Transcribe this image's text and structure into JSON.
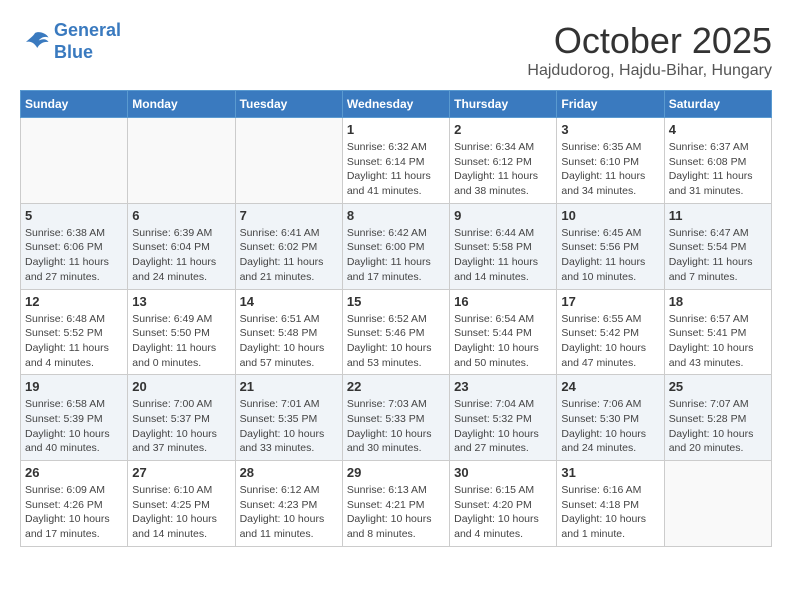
{
  "logo": {
    "line1": "General",
    "line2": "Blue"
  },
  "title": "October 2025",
  "subtitle": "Hajdudorog, Hajdu-Bihar, Hungary",
  "headers": [
    "Sunday",
    "Monday",
    "Tuesday",
    "Wednesday",
    "Thursday",
    "Friday",
    "Saturday"
  ],
  "weeks": [
    [
      {
        "day": "",
        "info": ""
      },
      {
        "day": "",
        "info": ""
      },
      {
        "day": "",
        "info": ""
      },
      {
        "day": "1",
        "info": "Sunrise: 6:32 AM\nSunset: 6:14 PM\nDaylight: 11 hours\nand 41 minutes."
      },
      {
        "day": "2",
        "info": "Sunrise: 6:34 AM\nSunset: 6:12 PM\nDaylight: 11 hours\nand 38 minutes."
      },
      {
        "day": "3",
        "info": "Sunrise: 6:35 AM\nSunset: 6:10 PM\nDaylight: 11 hours\nand 34 minutes."
      },
      {
        "day": "4",
        "info": "Sunrise: 6:37 AM\nSunset: 6:08 PM\nDaylight: 11 hours\nand 31 minutes."
      }
    ],
    [
      {
        "day": "5",
        "info": "Sunrise: 6:38 AM\nSunset: 6:06 PM\nDaylight: 11 hours\nand 27 minutes."
      },
      {
        "day": "6",
        "info": "Sunrise: 6:39 AM\nSunset: 6:04 PM\nDaylight: 11 hours\nand 24 minutes."
      },
      {
        "day": "7",
        "info": "Sunrise: 6:41 AM\nSunset: 6:02 PM\nDaylight: 11 hours\nand 21 minutes."
      },
      {
        "day": "8",
        "info": "Sunrise: 6:42 AM\nSunset: 6:00 PM\nDaylight: 11 hours\nand 17 minutes."
      },
      {
        "day": "9",
        "info": "Sunrise: 6:44 AM\nSunset: 5:58 PM\nDaylight: 11 hours\nand 14 minutes."
      },
      {
        "day": "10",
        "info": "Sunrise: 6:45 AM\nSunset: 5:56 PM\nDaylight: 11 hours\nand 10 minutes."
      },
      {
        "day": "11",
        "info": "Sunrise: 6:47 AM\nSunset: 5:54 PM\nDaylight: 11 hours\nand 7 minutes."
      }
    ],
    [
      {
        "day": "12",
        "info": "Sunrise: 6:48 AM\nSunset: 5:52 PM\nDaylight: 11 hours\nand 4 minutes."
      },
      {
        "day": "13",
        "info": "Sunrise: 6:49 AM\nSunset: 5:50 PM\nDaylight: 11 hours\nand 0 minutes."
      },
      {
        "day": "14",
        "info": "Sunrise: 6:51 AM\nSunset: 5:48 PM\nDaylight: 10 hours\nand 57 minutes."
      },
      {
        "day": "15",
        "info": "Sunrise: 6:52 AM\nSunset: 5:46 PM\nDaylight: 10 hours\nand 53 minutes."
      },
      {
        "day": "16",
        "info": "Sunrise: 6:54 AM\nSunset: 5:44 PM\nDaylight: 10 hours\nand 50 minutes."
      },
      {
        "day": "17",
        "info": "Sunrise: 6:55 AM\nSunset: 5:42 PM\nDaylight: 10 hours\nand 47 minutes."
      },
      {
        "day": "18",
        "info": "Sunrise: 6:57 AM\nSunset: 5:41 PM\nDaylight: 10 hours\nand 43 minutes."
      }
    ],
    [
      {
        "day": "19",
        "info": "Sunrise: 6:58 AM\nSunset: 5:39 PM\nDaylight: 10 hours\nand 40 minutes."
      },
      {
        "day": "20",
        "info": "Sunrise: 7:00 AM\nSunset: 5:37 PM\nDaylight: 10 hours\nand 37 minutes."
      },
      {
        "day": "21",
        "info": "Sunrise: 7:01 AM\nSunset: 5:35 PM\nDaylight: 10 hours\nand 33 minutes."
      },
      {
        "day": "22",
        "info": "Sunrise: 7:03 AM\nSunset: 5:33 PM\nDaylight: 10 hours\nand 30 minutes."
      },
      {
        "day": "23",
        "info": "Sunrise: 7:04 AM\nSunset: 5:32 PM\nDaylight: 10 hours\nand 27 minutes."
      },
      {
        "day": "24",
        "info": "Sunrise: 7:06 AM\nSunset: 5:30 PM\nDaylight: 10 hours\nand 24 minutes."
      },
      {
        "day": "25",
        "info": "Sunrise: 7:07 AM\nSunset: 5:28 PM\nDaylight: 10 hours\nand 20 minutes."
      }
    ],
    [
      {
        "day": "26",
        "info": "Sunrise: 6:09 AM\nSunset: 4:26 PM\nDaylight: 10 hours\nand 17 minutes."
      },
      {
        "day": "27",
        "info": "Sunrise: 6:10 AM\nSunset: 4:25 PM\nDaylight: 10 hours\nand 14 minutes."
      },
      {
        "day": "28",
        "info": "Sunrise: 6:12 AM\nSunset: 4:23 PM\nDaylight: 10 hours\nand 11 minutes."
      },
      {
        "day": "29",
        "info": "Sunrise: 6:13 AM\nSunset: 4:21 PM\nDaylight: 10 hours\nand 8 minutes."
      },
      {
        "day": "30",
        "info": "Sunrise: 6:15 AM\nSunset: 4:20 PM\nDaylight: 10 hours\nand 4 minutes."
      },
      {
        "day": "31",
        "info": "Sunrise: 6:16 AM\nSunset: 4:18 PM\nDaylight: 10 hours\nand 1 minute."
      },
      {
        "day": "",
        "info": ""
      }
    ]
  ]
}
